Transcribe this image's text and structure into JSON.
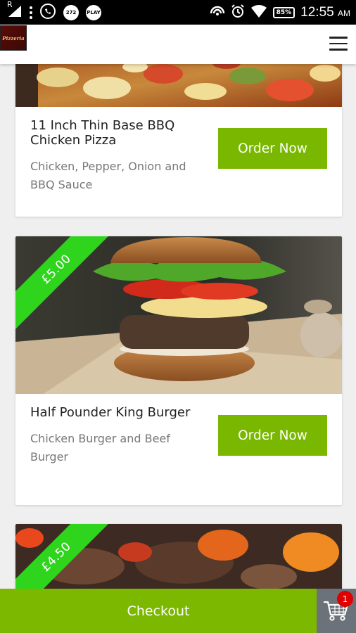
{
  "status_bar": {
    "carrier_badge": "R",
    "icon_272": "272",
    "icon_play": "PLAY",
    "wifi_label": "WiFi",
    "battery": "85%",
    "time": "12:55",
    "time_suffix": "AM"
  },
  "header": {
    "logo_text": "Pizzeria"
  },
  "products": [
    {
      "title": "11 Inch Thin Base BBQ Chicken Pizza",
      "description": "Chicken, Pepper, Onion and BBQ Sauce",
      "button": "Order Now"
    },
    {
      "title": "Half Pounder King Burger",
      "description": "Chicken Burger and Beef Burger",
      "price": "£5.00",
      "button": "Order Now"
    },
    {
      "price": "£4.50"
    }
  ],
  "footer": {
    "checkout_label": "Checkout",
    "cart_count": "1"
  },
  "colors": {
    "accent_green": "#79b700",
    "ribbon_green": "#2fd41c",
    "badge_red": "#e00000"
  }
}
